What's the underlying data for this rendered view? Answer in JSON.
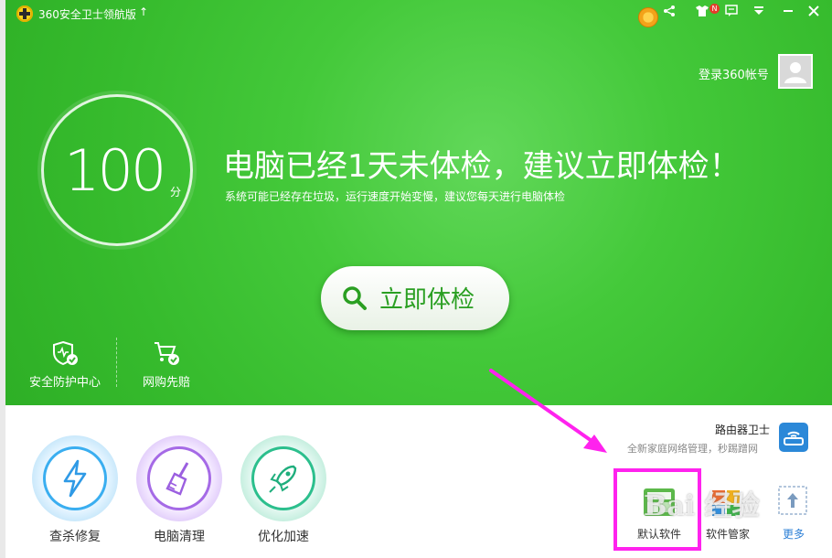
{
  "titlebar": {
    "app_title": "360安全卫士领航版",
    "update_glyph": "↑",
    "notification_badge": "N"
  },
  "account": {
    "login_label": "登录360帐号"
  },
  "score": {
    "value": "100",
    "unit": "分"
  },
  "hero": {
    "headline": "电脑已经1天未体检，建议立即体检！",
    "subline": "系统可能已经存在垃圾，运行速度开始变慢，建议您每天进行电脑体检",
    "check_button": "立即体检"
  },
  "features": [
    {
      "label": "安全防护中心"
    },
    {
      "label": "网购先赔"
    }
  ],
  "tools": [
    {
      "label": "查杀修复"
    },
    {
      "label": "电脑清理"
    },
    {
      "label": "优化加速"
    }
  ],
  "router": {
    "title": "路由器卫士",
    "subtitle": "全新家庭网络管理，秒踢蹭网"
  },
  "small_tools": [
    {
      "label": "默认软件"
    },
    {
      "label": "软件管家"
    },
    {
      "label": "更多"
    }
  ],
  "watermark": "Bai 经验",
  "colors": {
    "accent_green": "#3cc233",
    "highlight_magenta": "#ff22ee",
    "link_blue": "#2b7fd6"
  }
}
